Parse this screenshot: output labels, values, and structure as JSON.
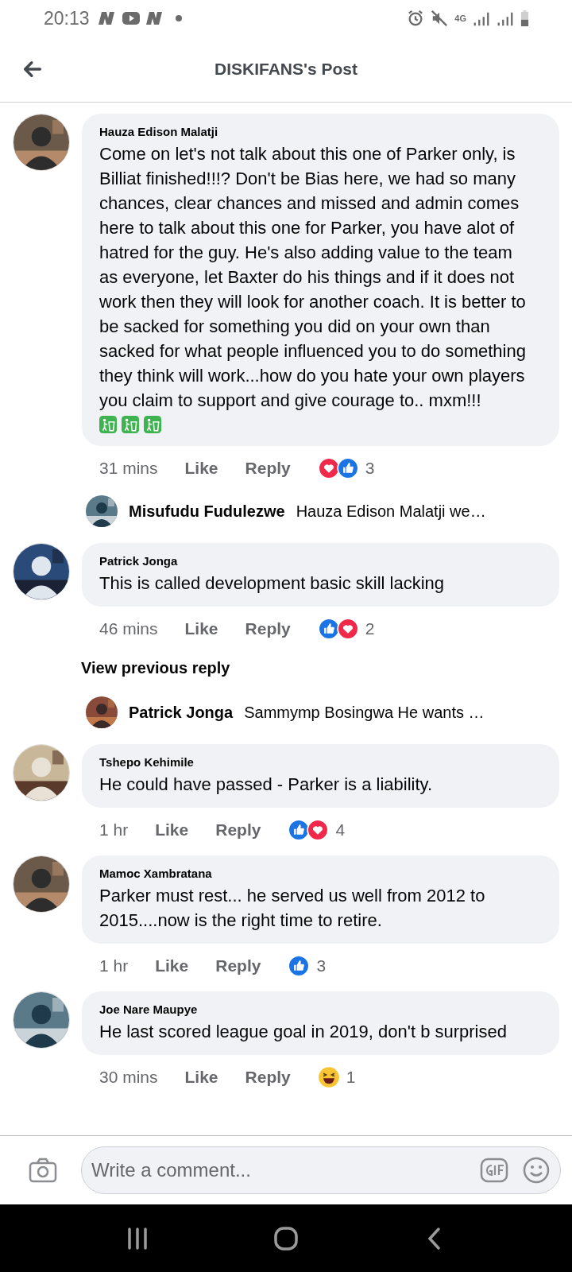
{
  "status_bar": {
    "time": "20:13",
    "network": "4G"
  },
  "header": {
    "title": "DISKIFANS's Post"
  },
  "feed": [
    {
      "kind": "comment",
      "author": "Hauza Edison Malatji",
      "text": "Come on let's not talk about this one of Parker only, is Billiat finished!!!? Don't be Bias here, we had so many chances, clear chances and missed and admin comes here to talk about this one for Parker, you have alot of hatred for the guy. He's also adding value to the team as everyone, let Baxter do his things and if it does not work then they will look for another coach. It is better to be sacked for something you did on your own than sacked for what people influenced you to do something they think will work...how do you hate your own players you claim to support and give courage to.. mxm!!!",
      "trailing_icons": [
        {
          "kind": "litter"
        },
        {
          "kind": "litter"
        },
        {
          "kind": "litter"
        }
      ],
      "time": "31 mins",
      "like": "Like",
      "reply": "Reply",
      "reactions": [
        {
          "kind": "love"
        },
        {
          "kind": "like"
        }
      ],
      "reaction_count": "3"
    },
    {
      "kind": "reply",
      "author": "Misufudu Fudulezwe",
      "text": "Hauza Edison Malatji we…"
    },
    {
      "kind": "comment",
      "author": "Patrick Jonga",
      "text": "This is called development basic skill lacking",
      "time": "46 mins",
      "like": "Like",
      "reply": "Reply",
      "reactions": [
        {
          "kind": "like"
        },
        {
          "kind": "love"
        }
      ],
      "reaction_count": "2"
    },
    {
      "kind": "more",
      "text": "View previous reply"
    },
    {
      "kind": "reply",
      "author": "Patrick Jonga",
      "text": "Sammymp Bosingwa He wants …"
    },
    {
      "kind": "comment",
      "author": "Tshepo Kehimile",
      "text": "He could have passed - Parker is a liability.",
      "time": "1 hr",
      "like": "Like",
      "reply": "Reply",
      "reactions": [
        {
          "kind": "like"
        },
        {
          "kind": "love"
        }
      ],
      "reaction_count": "4"
    },
    {
      "kind": "comment",
      "author": "Mamoc Xambratana",
      "text": "Parker must rest... he served us well from 2012 to 2015....now is the right time to retire.",
      "time": "1 hr",
      "like": "Like",
      "reply": "Reply",
      "reactions": [
        {
          "kind": "like"
        }
      ],
      "reaction_count": "3"
    },
    {
      "kind": "comment",
      "author": "Joe Nare Maupye",
      "text": "He last scored league goal in 2019, don't b surprised",
      "time": "30 mins",
      "like": "Like",
      "reply": "Reply",
      "reactions": [
        {
          "kind": "haha"
        }
      ],
      "reaction_count": "1"
    }
  ],
  "composer": {
    "placeholder": "Write a comment..."
  }
}
